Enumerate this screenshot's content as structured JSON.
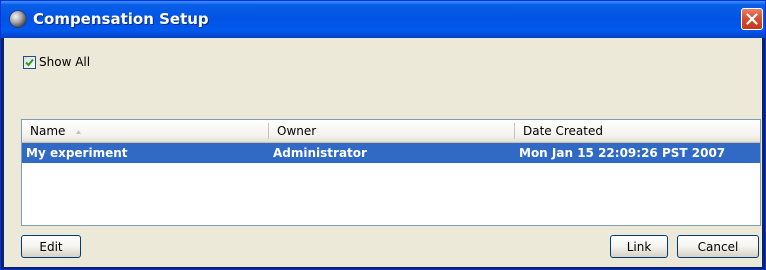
{
  "window": {
    "title": "Compensation Setup"
  },
  "options": {
    "show_all_label": "Show All",
    "show_all_checked": true
  },
  "table": {
    "columns": [
      "Name",
      "Owner",
      "Date Created"
    ],
    "rows": [
      [
        "My experiment",
        "Administrator",
        "Mon Jan 15 22:09:26 PST 2007"
      ]
    ],
    "selected_row": 0
  },
  "buttons": {
    "edit": "Edit",
    "link": "Link",
    "cancel": "Cancel"
  },
  "colors": {
    "title_bar": "#0054e3",
    "selection": "#316ac5",
    "dialog_bg": "#ece9d8",
    "close_button": "#d6502f"
  }
}
